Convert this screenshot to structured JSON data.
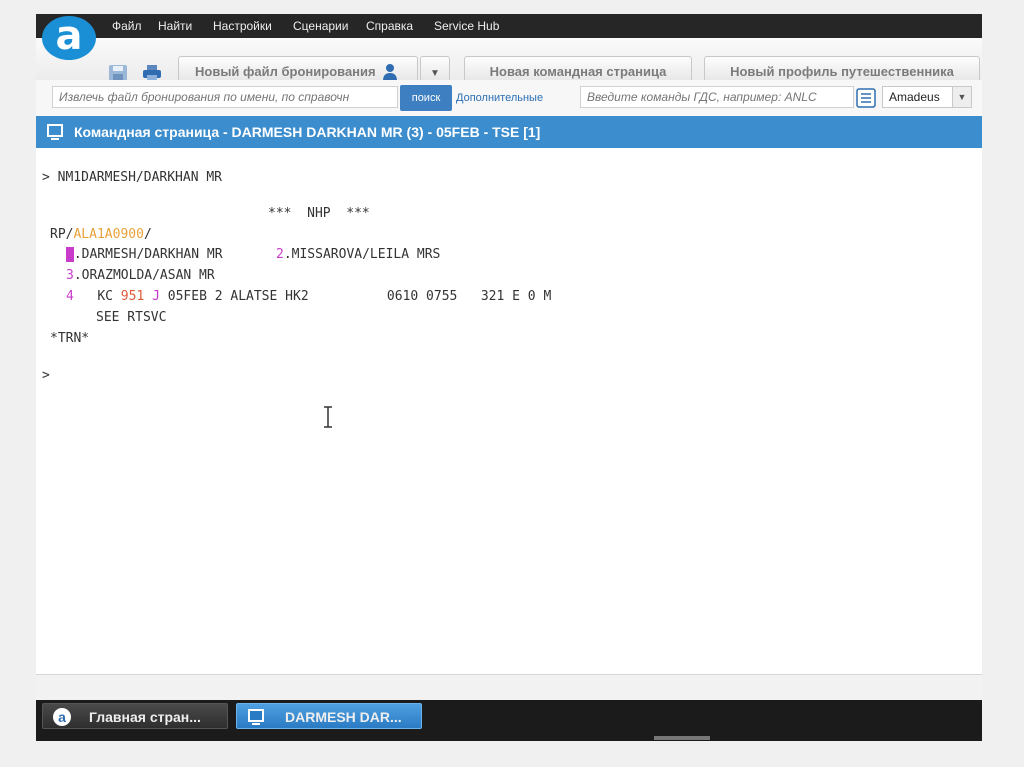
{
  "menu": [
    "Файл",
    "Найти",
    "Настройки",
    "Сценарии",
    "Справка",
    "Service Hub"
  ],
  "toolbar": {
    "new_booking_label": "Новый файл бронирования",
    "new_command_page_label": "Новая командная страница",
    "new_profile_label": "Новый профиль путешественника"
  },
  "search": {
    "pnr_placeholder": "Извлечь файл бронирования по имени, по справочн",
    "search_button": "поиск",
    "advanced_link": "Дополнительные",
    "command_placeholder": "Введите команды ГДС, например: ANLC",
    "gds_value": "Amadeus"
  },
  "window_title": "Командная страница - DARMESH DARKHAN MR (3) - 05FEB - TSE [1]",
  "terminal": {
    "line1": "> NM1DARMESH/DARKHAN MR",
    "nhp": "***  NHP  ***",
    "rp_prefix": "RP/",
    "office_id": "ALA1A0900",
    "rp_suffix": "/",
    "pax1_num": "1",
    "pax1_name": ".DARMESH/DARKHAN MR",
    "pax2_num": "2",
    "pax2_name": ".MISSAROVA/LEILA MRS",
    "pax3_num": "3",
    "pax3_name": ".ORAZMOLDA/ASAN MR",
    "seg_num": "4",
    "seg_airline": "KC",
    "seg_flight": "951",
    "seg_class": "J",
    "seg_rest": " 05FEB 2 ALATSE HK2          0610 0755   321 E 0 M",
    "see_line": "SEE RTSVC",
    "trn": "*TRN*",
    "prompt": ">"
  },
  "taskbar": {
    "home_label": "Главная стран...",
    "page_label": "DARMESH DAR..."
  },
  "colors": {
    "accent": "#3c8dcd",
    "office_id": "#e8a23a",
    "index": "#c93ccb",
    "flight": "#e05a3a"
  }
}
